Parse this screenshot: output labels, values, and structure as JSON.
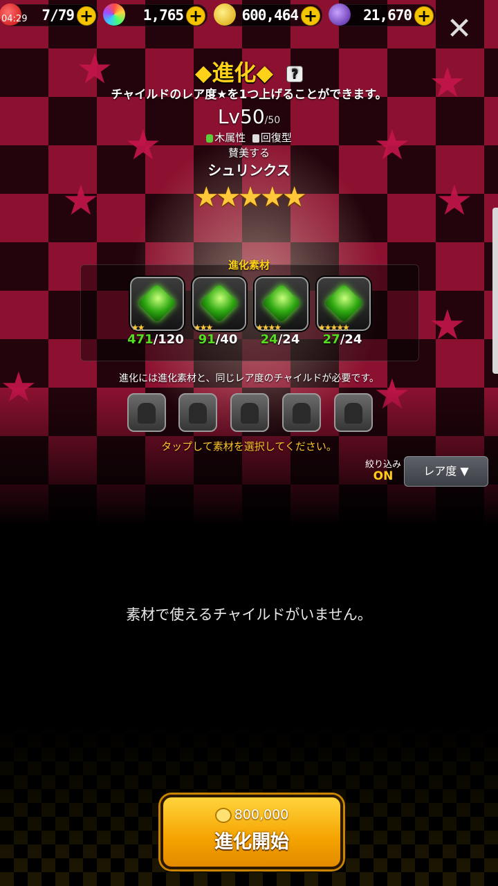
{
  "status": {
    "time": "04:29"
  },
  "resources": [
    {
      "icon": "heart-stamina-icon",
      "value": "7/79"
    },
    {
      "icon": "rainbow-orb-icon",
      "value": "1,765"
    },
    {
      "icon": "gold-coin-stack-icon",
      "value": "600,464"
    },
    {
      "icon": "purple-crystal-icon",
      "value": "21,670"
    }
  ],
  "header": {
    "title": "◆進化◆",
    "help_icon": "?",
    "description": "チャイルドのレア度★を1つ上げることができます。",
    "close_icon": "✕"
  },
  "character": {
    "level": "Lv50",
    "level_max": "/50",
    "attribute": "木属性",
    "type": "回復型",
    "subtitle": "賛美する",
    "name": "シュリンクス",
    "rarity_stars": "★★★★★"
  },
  "materials": {
    "label": "進化素材",
    "items": [
      {
        "stars": "★★",
        "have": "471",
        "need": "/120"
      },
      {
        "stars": "★★★",
        "have": "91",
        "need": "/40"
      },
      {
        "stars": "★★★★",
        "have": "24",
        "need": "/24"
      },
      {
        "stars": "★★★★★",
        "have": "27",
        "need": "/24"
      }
    ]
  },
  "requirement_text": "進化には進化素材と、同じレア度のチャイルドが必要です。",
  "tap_text": "タップして素材を選択してください。",
  "filter": {
    "label": "絞り込み",
    "state": "ON",
    "sort_label": "レア度 ▼"
  },
  "empty_message": "素材で使えるチャイルドがいません。",
  "evolve": {
    "cost": "800,000",
    "label": "進化開始"
  },
  "colors": {
    "accent_gold": "#ffd21a",
    "have_green": "#55dd22",
    "bg_crimson": "#8c1130"
  }
}
